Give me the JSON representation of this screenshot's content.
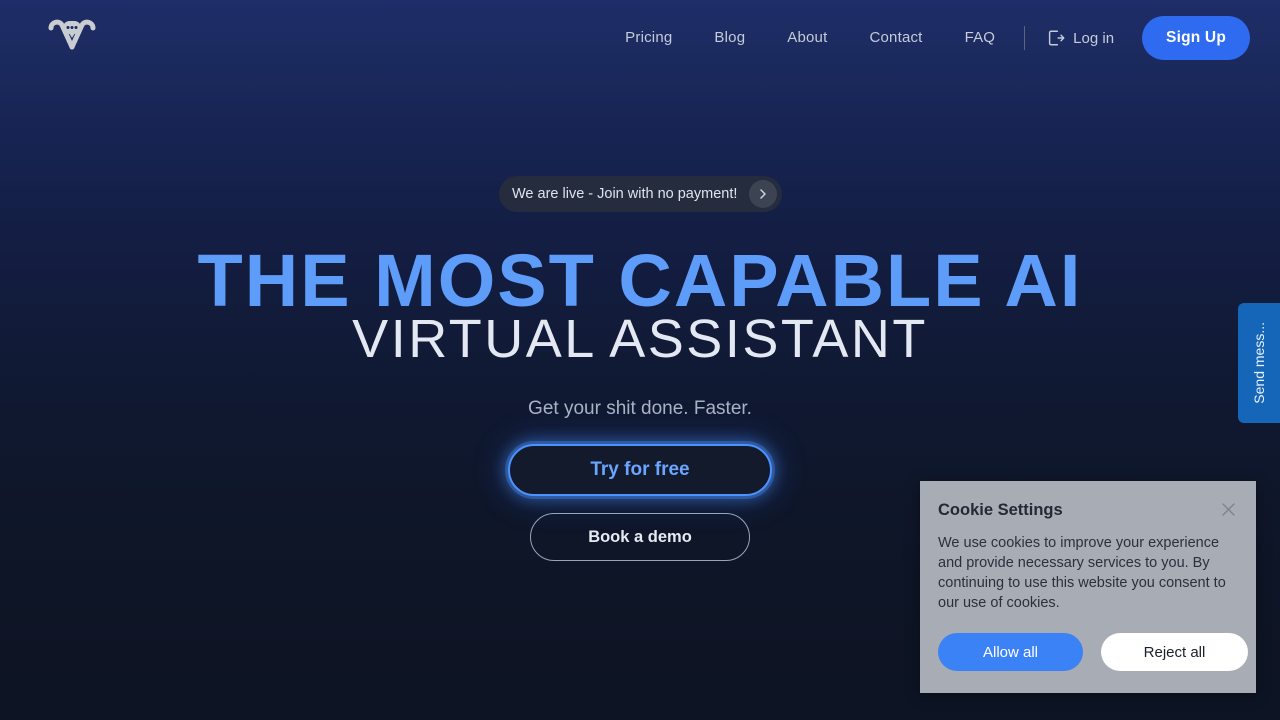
{
  "brand": {
    "logo_icon": "w-speech-bubble-logo",
    "accent_blue": "#2f6bf0",
    "heading_blue": "#5e9cf9"
  },
  "nav": {
    "links": [
      {
        "label": "Pricing"
      },
      {
        "label": "Blog"
      },
      {
        "label": "About"
      },
      {
        "label": "Contact"
      },
      {
        "label": "FAQ"
      }
    ],
    "login": {
      "label": "Log in",
      "icon": "login-door-icon"
    },
    "signup": {
      "label": "Sign Up"
    }
  },
  "hero": {
    "announcement": {
      "text": "We are live - Join with no payment!",
      "arrow_icon": "chevron-right-icon"
    },
    "headline_line1": "THE MOST CAPABLE AI",
    "headline_line2": "VIRTUAL ASSISTANT",
    "subtitle": "Get your shit done. Faster.",
    "primary_cta": "Try for free",
    "secondary_cta": "Book a demo"
  },
  "side_tab": {
    "label": "Send mess...",
    "color": "#1565b8"
  },
  "cookie": {
    "title": "Cookie Settings",
    "body": "We use cookies to improve your experience and provide necessary services to you. By continuing to use this website you consent to our use of cookies.",
    "allow_label": "Allow all",
    "reject_label": "Reject all",
    "close_icon": "close-icon"
  }
}
